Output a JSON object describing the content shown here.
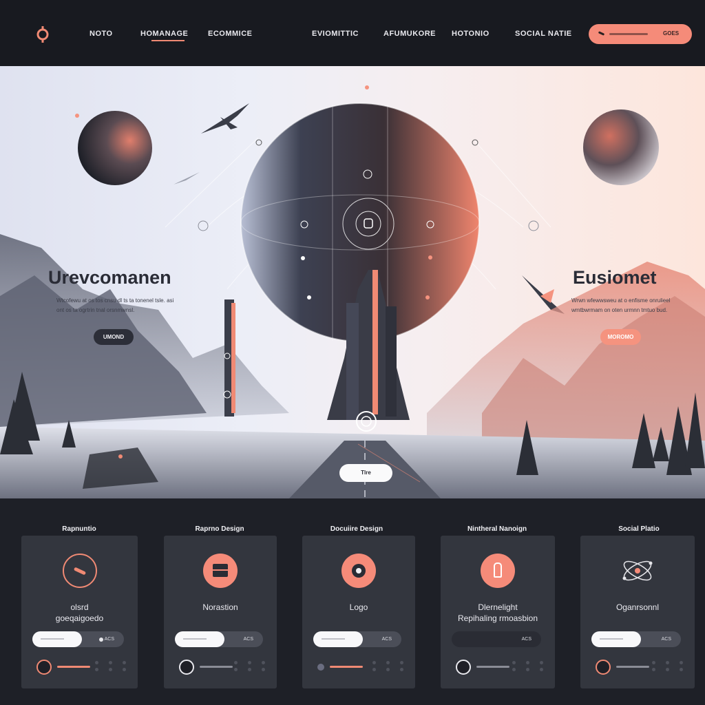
{
  "nav": {
    "items": [
      "NOTO",
      "HOMANAGE",
      "ECOMMICE",
      "EVIOMITTIC",
      "AFUMUKORE",
      "HOTONIO",
      "SOCIAL NATIE"
    ],
    "active_index": 1,
    "cta_label": "GOES"
  },
  "hero": {
    "left": {
      "title": "Urevcomanen",
      "text": "Wtcofewu at os tos cnsu dl ts ta tonenel tsle. asi ont os ta ogrtrin tnal orsnmwnsl.",
      "button": "UMOND"
    },
    "right": {
      "title": "Eusiomet",
      "text": "Wrwn wfewwsweu at o enfisme onrulieel wmtbwrmam on oten urmnn tmtuo bud.",
      "button": "MOROMO"
    },
    "center_button": "Tlre"
  },
  "cards": [
    {
      "title": "Rapnuntio",
      "label": "olsrd\ngoeqaigoedo",
      "icon": "dash-icon",
      "toggle_off": "ACS"
    },
    {
      "title": "Raprno Design",
      "label": "Norastion",
      "icon": "square-icon",
      "toggle_off": "ACS"
    },
    {
      "title": "Docuiire Design",
      "label": "Logo",
      "icon": "camera-icon",
      "toggle_off": "ACS"
    },
    {
      "title": "Nintheral Nanoign",
      "label": "Dlernelight\nRepihaling rmoasbion",
      "icon": "tower-icon",
      "toggle_off": "ACS"
    },
    {
      "title": "Social Platio",
      "label": "Oganrsonnl",
      "icon": "atom-icon",
      "toggle_off": "ACS"
    }
  ],
  "colors": {
    "accent": "#f58b79",
    "nav_bg": "#181a20",
    "card_bg": "#33363e",
    "section_bg": "#1e2027"
  }
}
